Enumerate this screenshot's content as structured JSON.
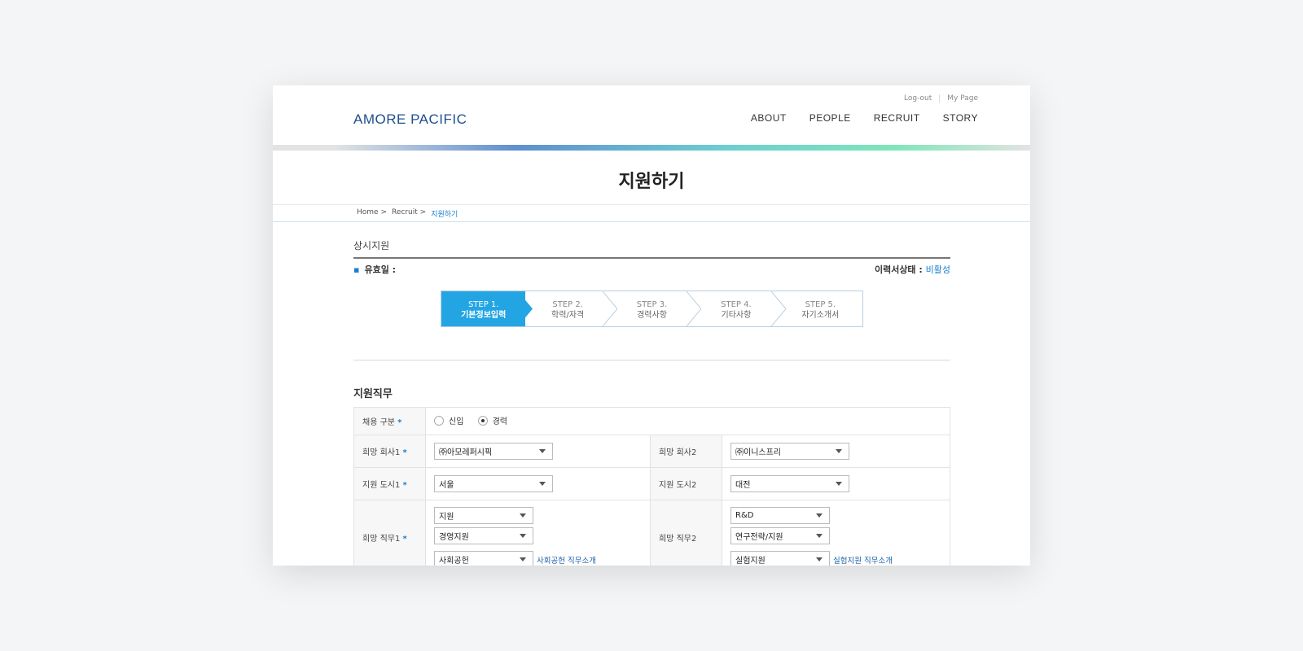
{
  "header": {
    "util": {
      "logout": "Log-out",
      "mypage": "My Page"
    },
    "logo": {
      "part1": "AMO",
      "part2": "RE",
      "part3": "PACIFIC"
    },
    "nav": [
      "ABOUT",
      "PEOPLE",
      "RECRUIT",
      "STORY"
    ]
  },
  "page_title": "지원하기",
  "breadcrumb": {
    "home": "Home",
    "recruit": "Recruit",
    "current": "지원하기",
    "sep": ">"
  },
  "section": {
    "title": "상시지원",
    "valid_label": "유효일 :",
    "status_label": "이력서상태 :",
    "status_value": "비활성"
  },
  "steps": [
    {
      "num": "STEP 1.",
      "label": "기본정보입력",
      "active": true
    },
    {
      "num": "STEP 2.",
      "label": "학력/자격",
      "active": false
    },
    {
      "num": "STEP 3.",
      "label": "경력사항",
      "active": false
    },
    {
      "num": "STEP 4.",
      "label": "기타사항",
      "active": false
    },
    {
      "num": "STEP 5.",
      "label": "자기소개서",
      "active": false
    }
  ],
  "job": {
    "title": "지원직무",
    "req_mark": "*",
    "hire_type": {
      "label": "채용 구분",
      "options": [
        "신입",
        "경력"
      ],
      "selected": "경력"
    },
    "company1": {
      "label": "희망 회사1",
      "value": "㈜아모레퍼시픽"
    },
    "company2": {
      "label": "희망 회사2",
      "value": "㈜이니스프리"
    },
    "city1": {
      "label": "지원 도시1",
      "value": "서울"
    },
    "city2": {
      "label": "지원 도시2",
      "value": "대전"
    },
    "duty1": {
      "label": "희망 직무1",
      "values": [
        "지원",
        "경영지원",
        "사회공헌"
      ],
      "link": "사회공헌 직무소개"
    },
    "duty2": {
      "label": "희망 직무2",
      "values": [
        "R&D",
        "연구전략/지원",
        "실험지원"
      ],
      "link": "실험지원 직무소개"
    }
  },
  "colors": {
    "accent": "#23a5e4",
    "link": "#1a7fcf",
    "brand": "#1f4e8f"
  }
}
